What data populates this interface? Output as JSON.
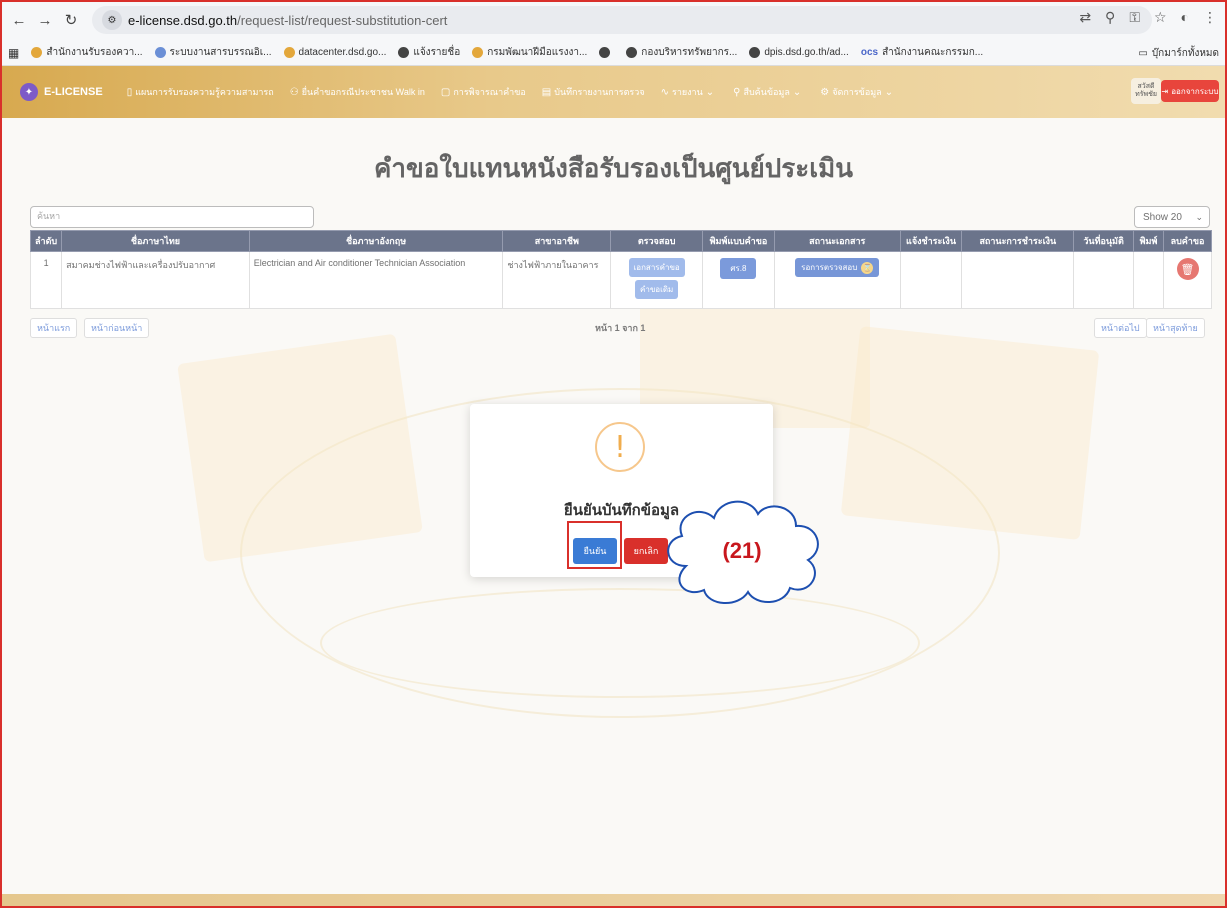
{
  "browser": {
    "url_host": "e-license.dsd.go.th",
    "url_path": "/request-list/request-substitution-cert",
    "bookmarks": [
      "สำนักงานรับรองควา...",
      "ระบบงานสารบรรณอิเ...",
      "datacenter.dsd.go...",
      "แจ้งรายชื่อ",
      "กรมพัฒนาฝีมือแรงงา...",
      "",
      "กองบริหารทรัพยากร...",
      "dpis.dsd.go.th/ad...",
      "สำนักงานคณะกรรมก..."
    ],
    "all_bookmarks": "บุ๊กมาร์กทั้งหมด"
  },
  "header": {
    "logo": "E-LICENSE",
    "nav": [
      "แผนการรับรองความรู้ความสามารถ",
      "ยื่นคำขอกรณีประชาชน Walk in",
      "การพิจารณาคำขอ",
      "บันทึกรายงานการตรวจ",
      "รายงาน",
      "สืบค้นข้อมูล",
      "จัดการข้อมูล"
    ],
    "user": "สวัสดี ทรัพชัย",
    "logout": "ออกจากระบบ"
  },
  "page": {
    "title": "คำขอใบแทนหนังสือรับรองเป็นศูนย์ประเมิน",
    "search_placeholder": "ค้นหา",
    "show": "Show 20"
  },
  "table": {
    "headers": [
      "ลำดับ",
      "ชื่อภาษาไทย",
      "ชื่อภาษาอังกฤษ",
      "สาขาอาชีพ",
      "ตรวจสอบ",
      "พิมพ์แบบคำขอ",
      "สถานะเอกสาร",
      "แจ้งชำระเงิน",
      "สถานะการชำระเงิน",
      "วันที่อนุมัติ",
      "พิมพ์",
      "ลบคำขอ"
    ],
    "row": {
      "no": "1",
      "thai": "สมาคมช่างไฟฟ้าและเครื่องปรับอากาศ",
      "english": "Electrician and Air conditioner Technician Association",
      "branch": "ช่างไฟฟ้าภายในอาคาร",
      "check1": "เอกสารคำขอ",
      "check2": "คำขอเดิม",
      "form": "ศร.8",
      "status": "รอการตรวจสอบ"
    }
  },
  "pagination": {
    "first": "หน้าแรก",
    "prev": "หน้าก่อนหน้า",
    "info": "หน้า 1 จาก 1",
    "next": "หน้าต่อไป",
    "last": "หน้าสุดท้าย"
  },
  "modal": {
    "icon": "!",
    "title": "ยืนยันบันทึกข้อมูล",
    "confirm": "ยืนยัน",
    "cancel": "ยกเลิก"
  },
  "callout": "(21)"
}
